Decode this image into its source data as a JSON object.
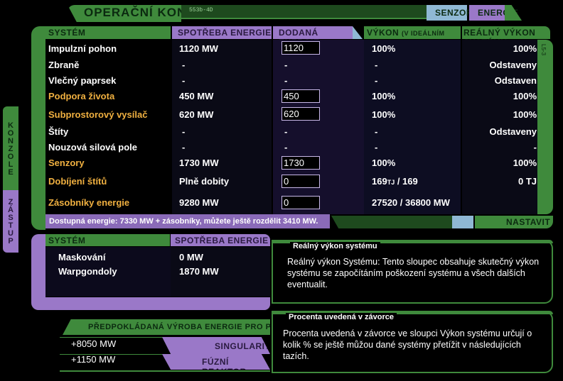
{
  "header": {
    "title": "OPERAČNÍ KONZOLE",
    "code": "553b-4D",
    "tab_senzory": "SENZORY",
    "tab_energie": "ENERGIE"
  },
  "side_tab": {
    "konzole": "KONZOLE",
    "zastup": "ZÁSTUP"
  },
  "main_table": {
    "columns": {
      "system": "SYSTÉM",
      "spotreba": "SPOTŘEBA ENERGIE",
      "dodana": "DODANÁ ENERGIE",
      "vykon": "VÝKON",
      "vykon_note": "(V IDEÁLNÍM STAVU)",
      "realny": "REÁLNÝ VÝKON SYSTÉMU"
    },
    "rows": [
      {
        "name": "Impulzní pohon",
        "spotreba": "1120 MW",
        "dodana": "1120",
        "vykon": "100%",
        "realny": "100%"
      },
      {
        "name": "Zbraně",
        "spotreba": "-",
        "dodana": "-",
        "vykon": "-",
        "realny": "Odstaveny"
      },
      {
        "name": "Vlečný paprsek",
        "spotreba": "-",
        "dodana": "-",
        "vykon": "-",
        "realny": "Odstaven"
      },
      {
        "name": "Podpora života",
        "spotreba": "450 MW",
        "dodana": "450",
        "vykon": "100%",
        "realny": "100%"
      },
      {
        "name": "Subprostorový vysílač",
        "spotreba": "620 MW",
        "dodana": "620",
        "vykon": "100%",
        "realny": "100%"
      },
      {
        "name": "Štíty",
        "spotreba": "-",
        "dodana": "-",
        "vykon": "-",
        "realny": "Odstaveny"
      },
      {
        "name": "Nouzová silová pole",
        "spotreba": "-",
        "dodana": "-",
        "vykon": "-",
        "realny": "-"
      },
      {
        "name": "Senzory",
        "spotreba": "1730 MW",
        "dodana": "1730",
        "vykon": "100%",
        "realny": "100%"
      },
      {
        "name": "Dobíjení štítů",
        "spotreba": "Plně dobity",
        "dodana": "0",
        "vykon_main": "169",
        "vykon_unit": "TJ",
        "vykon_rest": " / 169",
        "realny": "0 TJ"
      },
      {
        "name": "Zásobníky energie",
        "spotreba": "9280 MW",
        "dodana": "0",
        "vykon": "27520 / 36800 MW",
        "realny": ""
      }
    ],
    "footer_text": "Dostupná energie: 7330 MW + zásobníky, můžete ještě rozdělit 3410 MW.",
    "set_button": "NASTAVIT",
    "side_code": "L5-3"
  },
  "secondary_table": {
    "columns": {
      "system": "SYSTÉM",
      "spotreba": "SPOTŘEBA ENERGIE"
    },
    "rows": [
      {
        "name": "Maskování",
        "spotreba": "0 MW"
      },
      {
        "name": "Warpgondoly",
        "spotreba": "1870 MW"
      }
    ]
  },
  "forecast": {
    "title": "PŘEDPOKLÁDANÁ VÝROBA ENERGIE PRO PŘÍŠTÍ TAH",
    "rows": [
      {
        "value": "+8050 MW",
        "label": "SINGULARITA"
      },
      {
        "value": "+1150 MW",
        "label": "FÚZNÍ REAKTOR"
      }
    ]
  },
  "tooltips": [
    {
      "title": "Reálný výkon systému",
      "body": "Reálný výkon Systému: Tento sloupec obsahuje skutečný výkon systému se započítáním poškození systému a všech dalších eventualit."
    },
    {
      "title": "Procenta uvedená v závorce",
      "body": "Procenta uvedená v závorce ve sloupci Výkon systému určují o kolik % se ještě můžou dané systémy přetížit v následujících tazích."
    }
  ],
  "colors": {
    "green": "#3f8a3c",
    "purple": "#9a78c8",
    "blue": "#8fb8d4",
    "orange": "#f0b040",
    "dark_panel": "#0c0a1c"
  }
}
